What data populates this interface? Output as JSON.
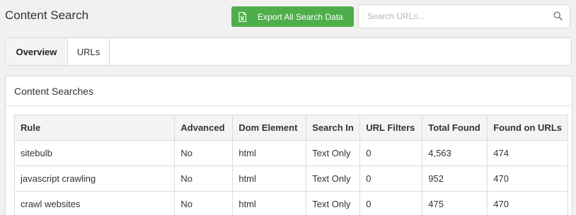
{
  "header": {
    "title": "Content Search",
    "export_label": "Export All Search Data",
    "export_icon": "excel-file-icon",
    "search_placeholder": "Search URLs...",
    "search_value": "",
    "search_icon": "magnifier-icon"
  },
  "tabs": [
    {
      "label": "Overview",
      "active": true
    },
    {
      "label": "URLs",
      "active": false
    }
  ],
  "panel": {
    "title": "Content Searches"
  },
  "table": {
    "columns": [
      "Rule",
      "Advanced",
      "Dom Element",
      "Search In",
      "URL Filters",
      "Total Found",
      "Found on URLs"
    ],
    "rows": [
      [
        "sitebulb",
        "No",
        "html",
        "Text Only",
        "0",
        "4,563",
        "474"
      ],
      [
        "javascript crawling",
        "No",
        "html",
        "Text Only",
        "0",
        "952",
        "470"
      ],
      [
        "crawl websites",
        "No",
        "html",
        "Text Only",
        "0",
        "475",
        "470"
      ]
    ]
  },
  "colors": {
    "accent_green": "#4fae4c",
    "background": "#f1f1f1"
  }
}
